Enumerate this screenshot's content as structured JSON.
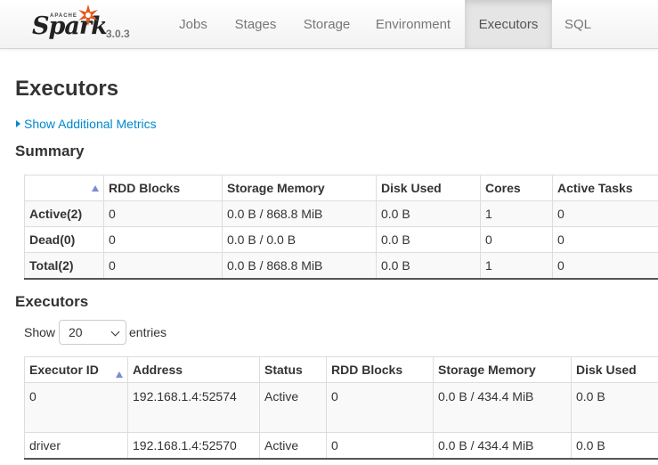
{
  "brand": {
    "apache": "APACHE",
    "name": "Spark",
    "version": "3.0.3"
  },
  "nav": {
    "tabs": [
      {
        "label": "Jobs"
      },
      {
        "label": "Stages"
      },
      {
        "label": "Storage"
      },
      {
        "label": "Environment"
      },
      {
        "label": "Executors",
        "active": true
      },
      {
        "label": "SQL"
      }
    ]
  },
  "page": {
    "title": "Executors",
    "additional_metrics_link": "Show Additional Metrics"
  },
  "summary": {
    "heading": "Summary",
    "columns": [
      "",
      "RDD Blocks",
      "Storage Memory",
      "Disk Used",
      "Cores",
      "Active Tasks"
    ],
    "rows": [
      [
        "Active(2)",
        "0",
        "0.0 B / 868.8 MiB",
        "0.0 B",
        "1",
        "0"
      ],
      [
        "Dead(0)",
        "0",
        "0.0 B / 0.0 B",
        "0.0 B",
        "0",
        "0"
      ],
      [
        "Total(2)",
        "0",
        "0.0 B / 868.8 MiB",
        "0.0 B",
        "1",
        "0"
      ]
    ]
  },
  "executors": {
    "heading": "Executors",
    "show_label": "Show",
    "entries_value": "20",
    "entries_label": "entries",
    "columns": [
      "Executor ID",
      "Address",
      "Status",
      "RDD Blocks",
      "Storage Memory",
      "Disk Used"
    ],
    "rows": [
      [
        "0",
        "192.168.1.4:52574",
        "Active",
        "0",
        "0.0 B / 434.4 MiB",
        "0.0 B"
      ],
      [
        "driver",
        "192.168.1.4:52570",
        "Active",
        "0",
        "0.0 B / 434.4 MiB",
        "0.0 B"
      ]
    ]
  },
  "colors": {
    "link": "#0088cc",
    "sort_arrow": "#7b8ccf",
    "spark_star": "#e25a1c"
  }
}
